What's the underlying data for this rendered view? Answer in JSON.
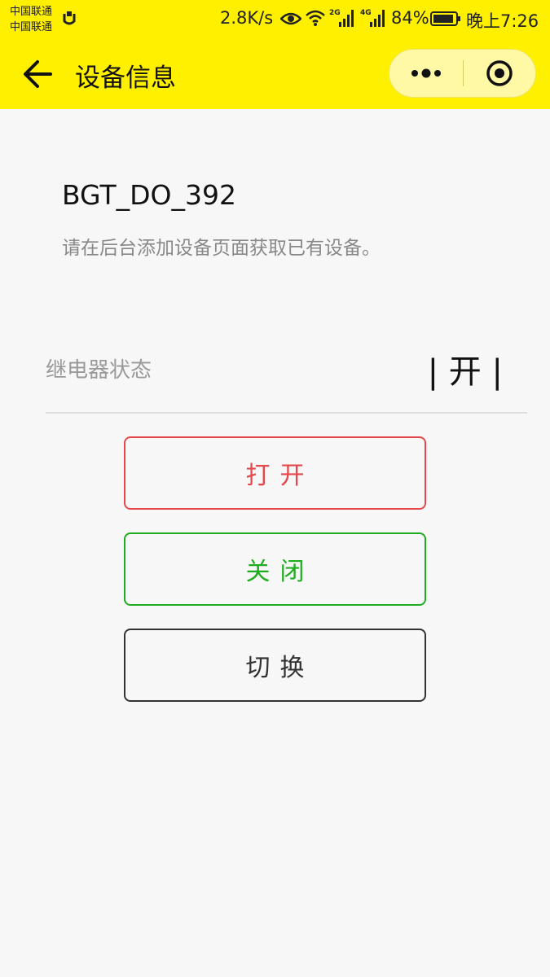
{
  "status_bar": {
    "carrier_1": "中国联通",
    "carrier_2": "中国联通",
    "net_speed": "2.8K/s",
    "signal_1_label": "2G",
    "signal_2_label": "4G",
    "battery_percent": "84%",
    "time": "晚上7:26",
    "icons": [
      "carrier-icon",
      "eye-icon",
      "wifi-icon",
      "signal-icon",
      "battery-icon"
    ]
  },
  "nav": {
    "title": "设备信息",
    "back_icon": "arrow-left-icon",
    "more_icon": "more-dots-icon",
    "close_icon": "target-circle-icon"
  },
  "device": {
    "name": "BGT_DO_392",
    "hint": "请在后台添加设备页面获取已有设备。"
  },
  "relay": {
    "label": "继电器状态",
    "value": "| 开 |"
  },
  "buttons": {
    "open": "打开",
    "close": "关闭",
    "toggle": "切换"
  },
  "colors": {
    "header_bg": "#fff000",
    "open": "#e5474b",
    "close": "#1fad1f",
    "toggle": "#333333"
  }
}
